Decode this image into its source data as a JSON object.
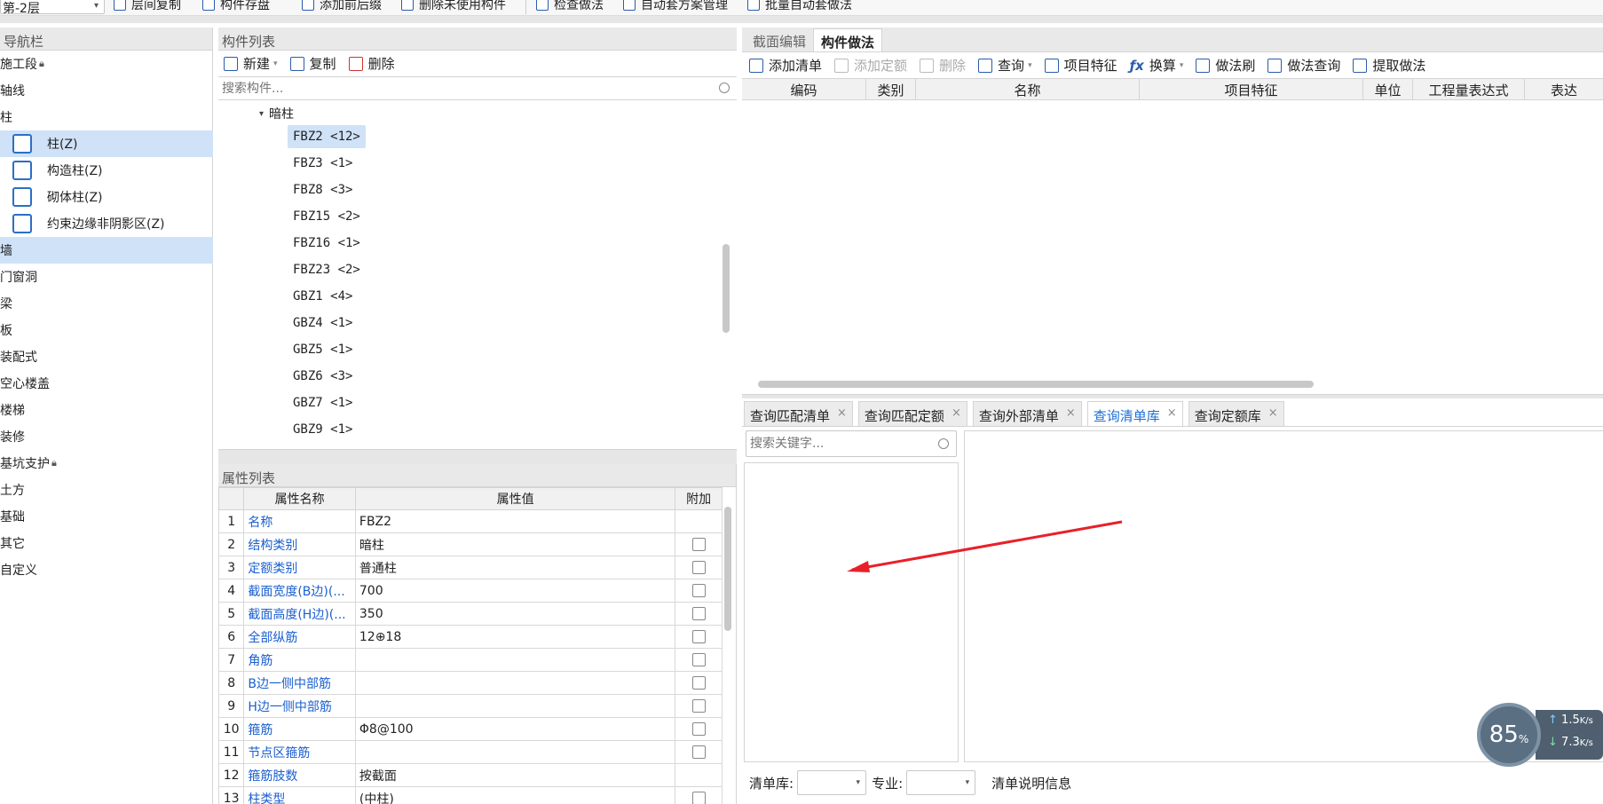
{
  "toolbar": {
    "floor": "第-2层",
    "buttons": [
      "层间复制",
      "构件存盘",
      "添加前后缀",
      "删除未使用构件",
      "检查做法",
      "自动套方案管理",
      "批量自动套做法"
    ]
  },
  "nav": {
    "title": "导航栏",
    "items": [
      {
        "label": "施工段",
        "lock": true
      },
      {
        "label": "轴线"
      },
      {
        "label": "柱"
      },
      {
        "label": "柱(Z)",
        "indent": true,
        "selected": true,
        "icon": "column-icon"
      },
      {
        "label": "构造柱(Z)",
        "indent": true,
        "icon": "constructional-column-icon"
      },
      {
        "label": "砌体柱(Z)",
        "indent": true,
        "icon": "masonry-column-icon"
      },
      {
        "label": "约束边缘非阴影区(Z)",
        "indent": true,
        "icon": "constraint-edge-icon"
      },
      {
        "label": "墙",
        "highlight": true
      },
      {
        "label": "门窗洞"
      },
      {
        "label": "梁"
      },
      {
        "label": "板"
      },
      {
        "label": "装配式"
      },
      {
        "label": "空心楼盖"
      },
      {
        "label": "楼梯"
      },
      {
        "label": "装修"
      },
      {
        "label": "基坑支护",
        "lock": true
      },
      {
        "label": "土方"
      },
      {
        "label": "基础"
      },
      {
        "label": "其它"
      },
      {
        "label": "自定义"
      }
    ]
  },
  "component_list": {
    "title": "构件列表",
    "new_label": "新建",
    "copy_label": "复制",
    "delete_label": "删除",
    "search_placeholder": "搜索构件...",
    "group": "暗柱",
    "items": [
      "FBZ2 <12>",
      "FBZ3 <1>",
      "FBZ8 <3>",
      "FBZ15 <2>",
      "FBZ16 <1>",
      "FBZ23 <2>",
      "GBZ1 <4>",
      "GBZ4 <1>",
      "GBZ5 <1>",
      "GBZ6 <3>",
      "GBZ7 <1>",
      "GBZ9 <1>"
    ]
  },
  "properties": {
    "title": "属性列表",
    "headers": [
      "属性名称",
      "属性值",
      "附加"
    ],
    "rows": [
      {
        "n": "1",
        "name": "名称",
        "value": "FBZ2",
        "cb": false
      },
      {
        "n": "2",
        "name": "结构类别",
        "value": "暗柱",
        "cb": true
      },
      {
        "n": "3",
        "name": "定额类别",
        "value": "普通柱",
        "cb": true
      },
      {
        "n": "4",
        "name": "截面宽度(B边)(...",
        "value": "700",
        "cb": true
      },
      {
        "n": "5",
        "name": "截面高度(H边)(...",
        "value": "350",
        "cb": true
      },
      {
        "n": "6",
        "name": "全部纵筋",
        "value": "12⊕18",
        "cb": true
      },
      {
        "n": "7",
        "name": "角筋",
        "value": "",
        "cb": true
      },
      {
        "n": "8",
        "name": "B边一侧中部筋",
        "value": "",
        "cb": true
      },
      {
        "n": "9",
        "name": "H边一侧中部筋",
        "value": "",
        "cb": true
      },
      {
        "n": "10",
        "name": "箍筋",
        "value": "Φ8@100",
        "cb": true
      },
      {
        "n": "11",
        "name": "节点区箍筋",
        "value": "",
        "cb": true
      },
      {
        "n": "12",
        "name": "箍筋肢数",
        "value": "按截面",
        "cb": false
      },
      {
        "n": "13",
        "name": "柱类型",
        "value": "(中柱)",
        "cb": true
      }
    ]
  },
  "method": {
    "tabs": [
      "截面编辑",
      "构件做法"
    ],
    "toolbar": [
      "添加清单",
      "添加定额",
      "删除",
      "查询",
      "项目特征",
      "换算",
      "做法刷",
      "做法查询",
      "提取做法"
    ],
    "columns": [
      "编码",
      "类别",
      "名称",
      "项目特征",
      "单位",
      "工程量表达式",
      "表达"
    ]
  },
  "query": {
    "tabs": [
      "查询匹配清单",
      "查询匹配定额",
      "查询外部清单",
      "查询清单库",
      "查询定额库"
    ],
    "active_tab": 3,
    "search_placeholder": "搜索关键字...",
    "lib_label": "清单库:",
    "major_label": "专业:",
    "info_label": "清单说明信息"
  },
  "widget": {
    "percent": "85",
    "pct_sign": "%",
    "up": "1.5",
    "down": "7.3",
    "unit": "K/s"
  },
  "colors": {
    "accent": "#1a6fd6",
    "selected": "#cfe2f7",
    "arrow": "#e8202a"
  }
}
